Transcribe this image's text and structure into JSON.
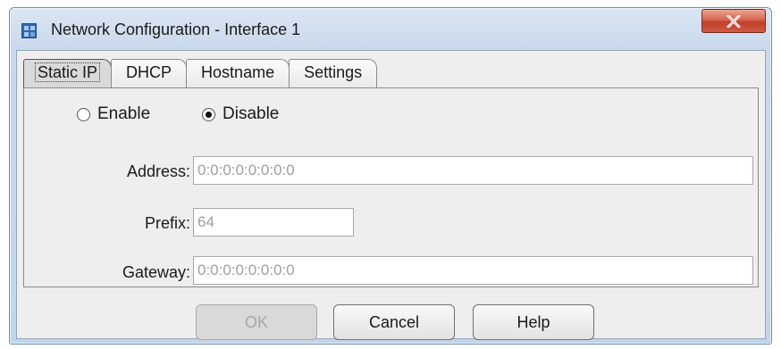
{
  "window": {
    "title": "Network Configuration - Interface 1",
    "close_icon": "close-x-icon",
    "app_icon": "network-config-icon"
  },
  "tabs": [
    {
      "label": "Static IP",
      "active": true
    },
    {
      "label": "DHCP",
      "active": false
    },
    {
      "label": "Hostname",
      "active": false
    },
    {
      "label": "Settings",
      "active": false
    }
  ],
  "static_ip": {
    "enable_label": "Enable",
    "disable_label": "Disable",
    "selected": "Disable",
    "address_label": "Address:",
    "address_value": "0:0:0:0:0:0:0:0",
    "prefix_label": "Prefix:",
    "prefix_value": "64",
    "gateway_label": "Gateway:",
    "gateway_value": "0:0:0:0:0:0:0:0"
  },
  "buttons": {
    "ok": "OK",
    "cancel": "Cancel",
    "help": "Help"
  }
}
